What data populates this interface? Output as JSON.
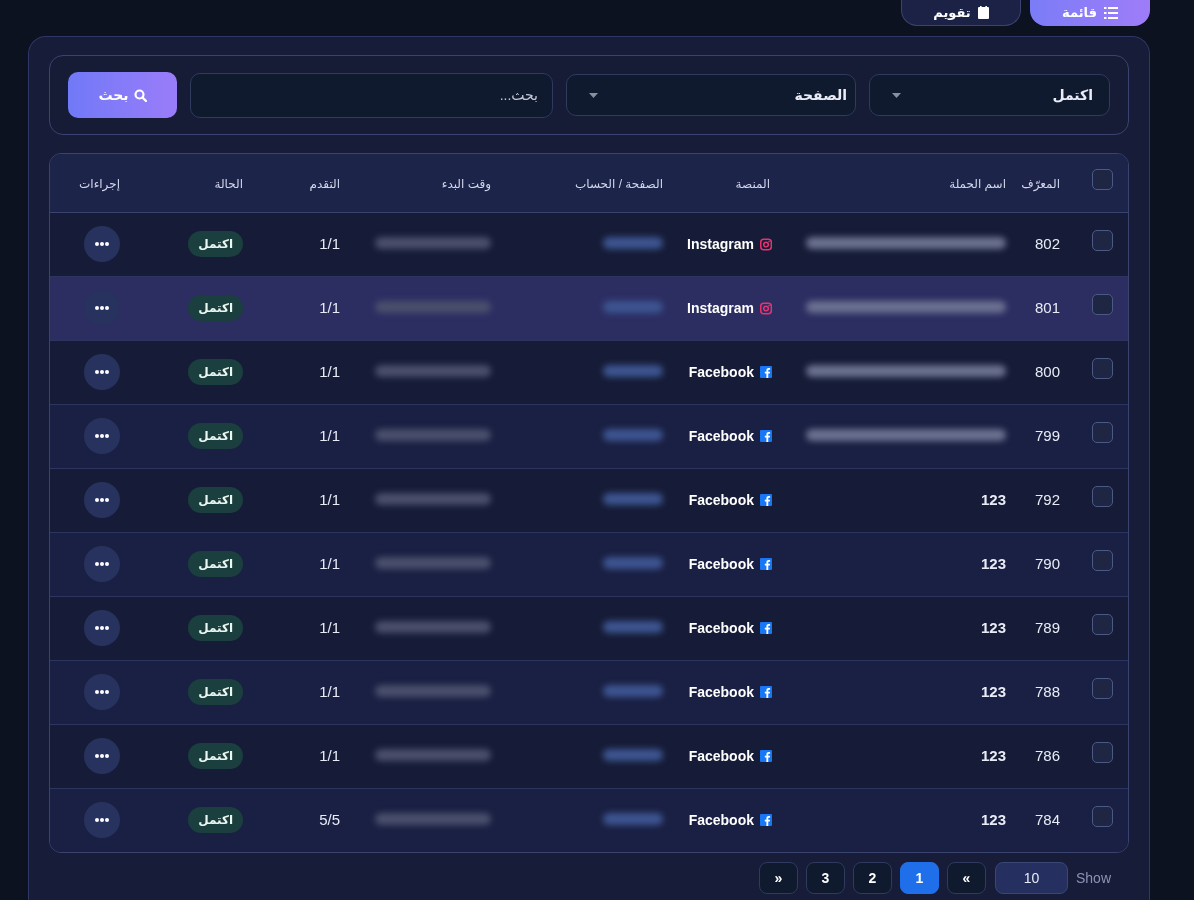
{
  "view_toggle": [
    {
      "label": "قائمة",
      "kind": "list",
      "selected": true
    },
    {
      "label": "تقويم",
      "kind": "calendar",
      "selected": false
    }
  ],
  "filters": {
    "status": {
      "value": "اكتمل"
    },
    "page": {
      "value": "الصفحة"
    },
    "search": {
      "placeholder": "بحث..."
    },
    "search_button": {
      "label": "بحث"
    }
  },
  "table": {
    "select_all": {
      "checked": false
    },
    "columns": [
      "المعرّف",
      "اسم الحملة",
      "المنصة",
      "الصفحة / الحساب",
      "وقت البدء",
      "التقدم",
      "الحالة",
      "إجراءات"
    ],
    "rows": [
      {
        "id": "802",
        "checked": false,
        "highlighted": false,
        "platform": {
          "kind": "instagram",
          "name": "Instagram"
        },
        "progress": "1/1",
        "status": "اكتمل"
      },
      {
        "id": "801",
        "checked": false,
        "highlighted": true,
        "platform": {
          "kind": "instagram",
          "name": "Instagram"
        },
        "progress": "1/1",
        "status": "اكتمل"
      },
      {
        "id": "800",
        "checked": false,
        "highlighted": false,
        "platform": {
          "kind": "facebook",
          "name": "Facebook"
        },
        "progress": "1/1",
        "status": "اكتمل"
      },
      {
        "id": "799",
        "checked": false,
        "highlighted": false,
        "platform": {
          "kind": "facebook",
          "name": "Facebook"
        },
        "progress": "1/1",
        "status": "اكتمل"
      },
      {
        "id": "792",
        "checked": false,
        "highlighted": false,
        "campaign_name": "123",
        "platform": {
          "kind": "facebook",
          "name": "Facebook"
        },
        "progress": "1/1",
        "status": "اكتمل"
      },
      {
        "id": "790",
        "checked": false,
        "highlighted": false,
        "campaign_name": "123",
        "platform": {
          "kind": "facebook",
          "name": "Facebook"
        },
        "progress": "1/1",
        "status": "اكتمل"
      },
      {
        "id": "789",
        "checked": false,
        "highlighted": false,
        "campaign_name": "123",
        "platform": {
          "kind": "facebook",
          "name": "Facebook"
        },
        "progress": "1/1",
        "status": "اكتمل"
      },
      {
        "id": "788",
        "checked": false,
        "highlighted": false,
        "campaign_name": "123",
        "platform": {
          "kind": "facebook",
          "name": "Facebook"
        },
        "progress": "1/1",
        "status": "اكتمل"
      },
      {
        "id": "786",
        "checked": false,
        "highlighted": false,
        "campaign_name": "123",
        "platform": {
          "kind": "facebook",
          "name": "Facebook"
        },
        "progress": "1/1",
        "status": "اكتمل"
      },
      {
        "id": "784",
        "checked": false,
        "highlighted": false,
        "campaign_name": "123",
        "platform": {
          "kind": "facebook",
          "name": "Facebook"
        },
        "progress": "5/5",
        "status": "اكتمل"
      }
    ]
  },
  "pagination": {
    "show_label": "Show",
    "page_size": "10",
    "pages": [
      {
        "label": "»",
        "selected": false
      },
      {
        "label": "1",
        "selected": true
      },
      {
        "label": "2",
        "selected": false
      },
      {
        "label": "3",
        "selected": false
      },
      {
        "label": "«",
        "selected": false
      }
    ]
  }
}
